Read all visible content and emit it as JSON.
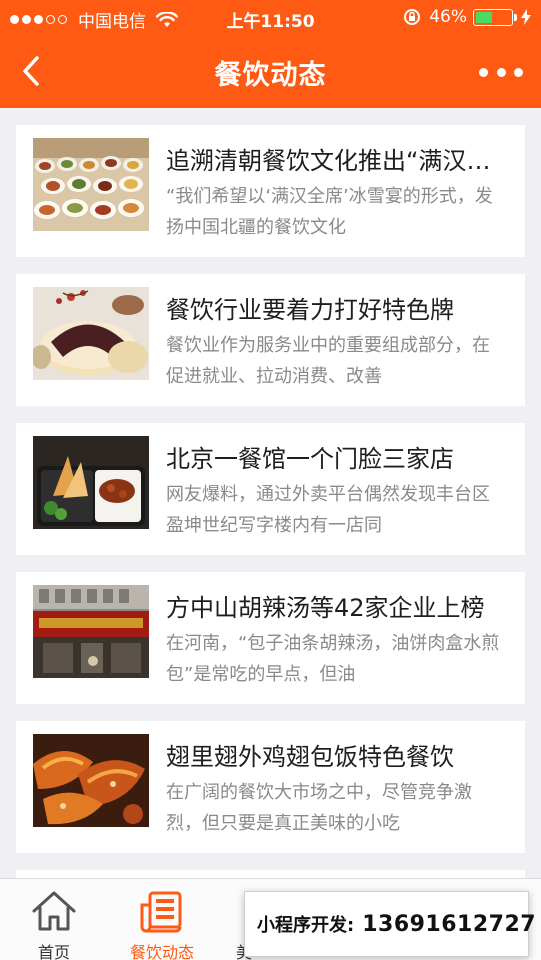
{
  "status_bar": {
    "carrier": "中国电信",
    "time": "上午11:50",
    "battery_percent": "46%",
    "battery_level": 0.46,
    "signal_dots_filled": 3,
    "signal_dots_total": 5
  },
  "nav": {
    "title": "餐饮动态",
    "back_icon": "chevron-left-icon",
    "more_icon": "more-dots-icon"
  },
  "articles": [
    {
      "title": "追溯清朝餐饮文化推出“满汉全席”冰雪宴",
      "desc": "“我们希望以‘满汉全席’冰雪宴的形式，发扬中国北疆的餐饮文化"
    },
    {
      "title": "餐饮行业要着力打好特色牌",
      "desc": "餐饮业作为服务业中的重要组成部分，在促进就业、拉动消费、改善"
    },
    {
      "title": "北京一餐馆一个门脸三家店",
      "desc": "网友爆料，通过外卖平台偶然发现丰台区盈坤世纪写字楼内有一店同"
    },
    {
      "title": "方中山胡辣汤等42家企业上榜",
      "desc": "在河南，“包子油条胡辣汤，油饼肉盒水煎包”是常吃的早点，但油"
    },
    {
      "title": "翅里翅外鸡翅包饭特色餐饮",
      "desc": "在广阔的餐饮大市场之中，尽管竞争激烈，但只要是真正美味的小吃"
    }
  ],
  "tabbar": {
    "tabs": [
      {
        "label": "首页",
        "icon": "home-icon"
      },
      {
        "label": "餐饮动态",
        "icon": "news-icon",
        "active": true
      },
      {
        "label": "美",
        "icon": "food-icon"
      }
    ],
    "accent_color": "#fe5a14"
  },
  "promo": {
    "label": "小程序开发:",
    "phone": "13691612727"
  }
}
